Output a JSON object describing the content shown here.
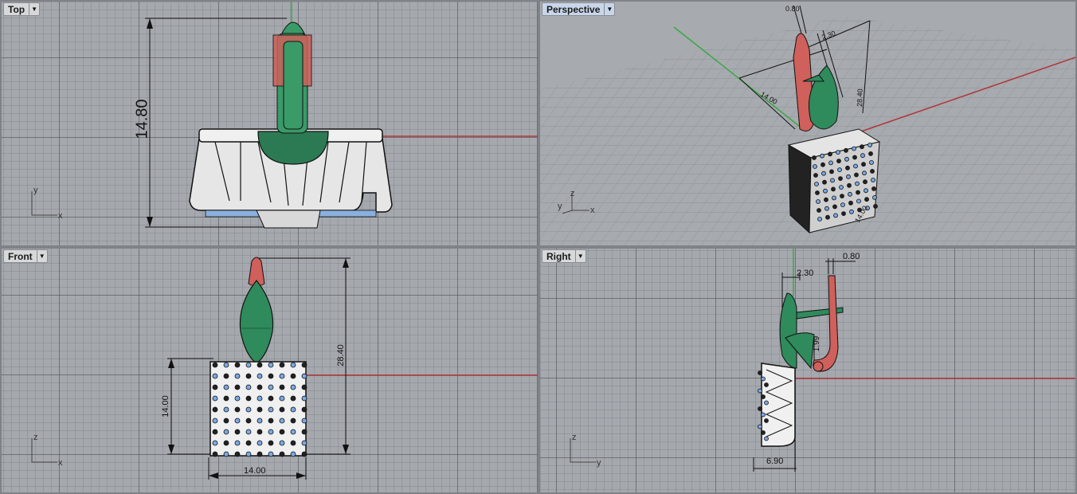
{
  "viewports": {
    "top": {
      "label": "Top",
      "dimension": "14.80",
      "axes": {
        "v": "y",
        "h": "x"
      }
    },
    "perspective": {
      "label": "Perspective",
      "dimensions": [
        "0.80",
        "2.30",
        "14.00",
        "28.40",
        "14.00"
      ],
      "axes": {
        "v": "z",
        "h": "x",
        "d": "y"
      }
    },
    "front": {
      "label": "Front",
      "dimensions": {
        "height": "28.40",
        "width_side": "14.00",
        "width_bottom": "14.00"
      },
      "axes": {
        "v": "z",
        "h": "x"
      }
    },
    "right": {
      "label": "Right",
      "dimensions": {
        "top": "0.80",
        "offset": "2.30",
        "hook": "1.99",
        "depth": "6.90"
      },
      "axes": {
        "v": "z",
        "h": "y"
      }
    }
  },
  "colors": {
    "viewport_bg": "#a5a8ad",
    "x_axis": "#b0363a",
    "y_axis": "#3aa846",
    "green_part": "#2f8a5c",
    "red_part": "#d0605b",
    "points": "#7aa9e6"
  }
}
